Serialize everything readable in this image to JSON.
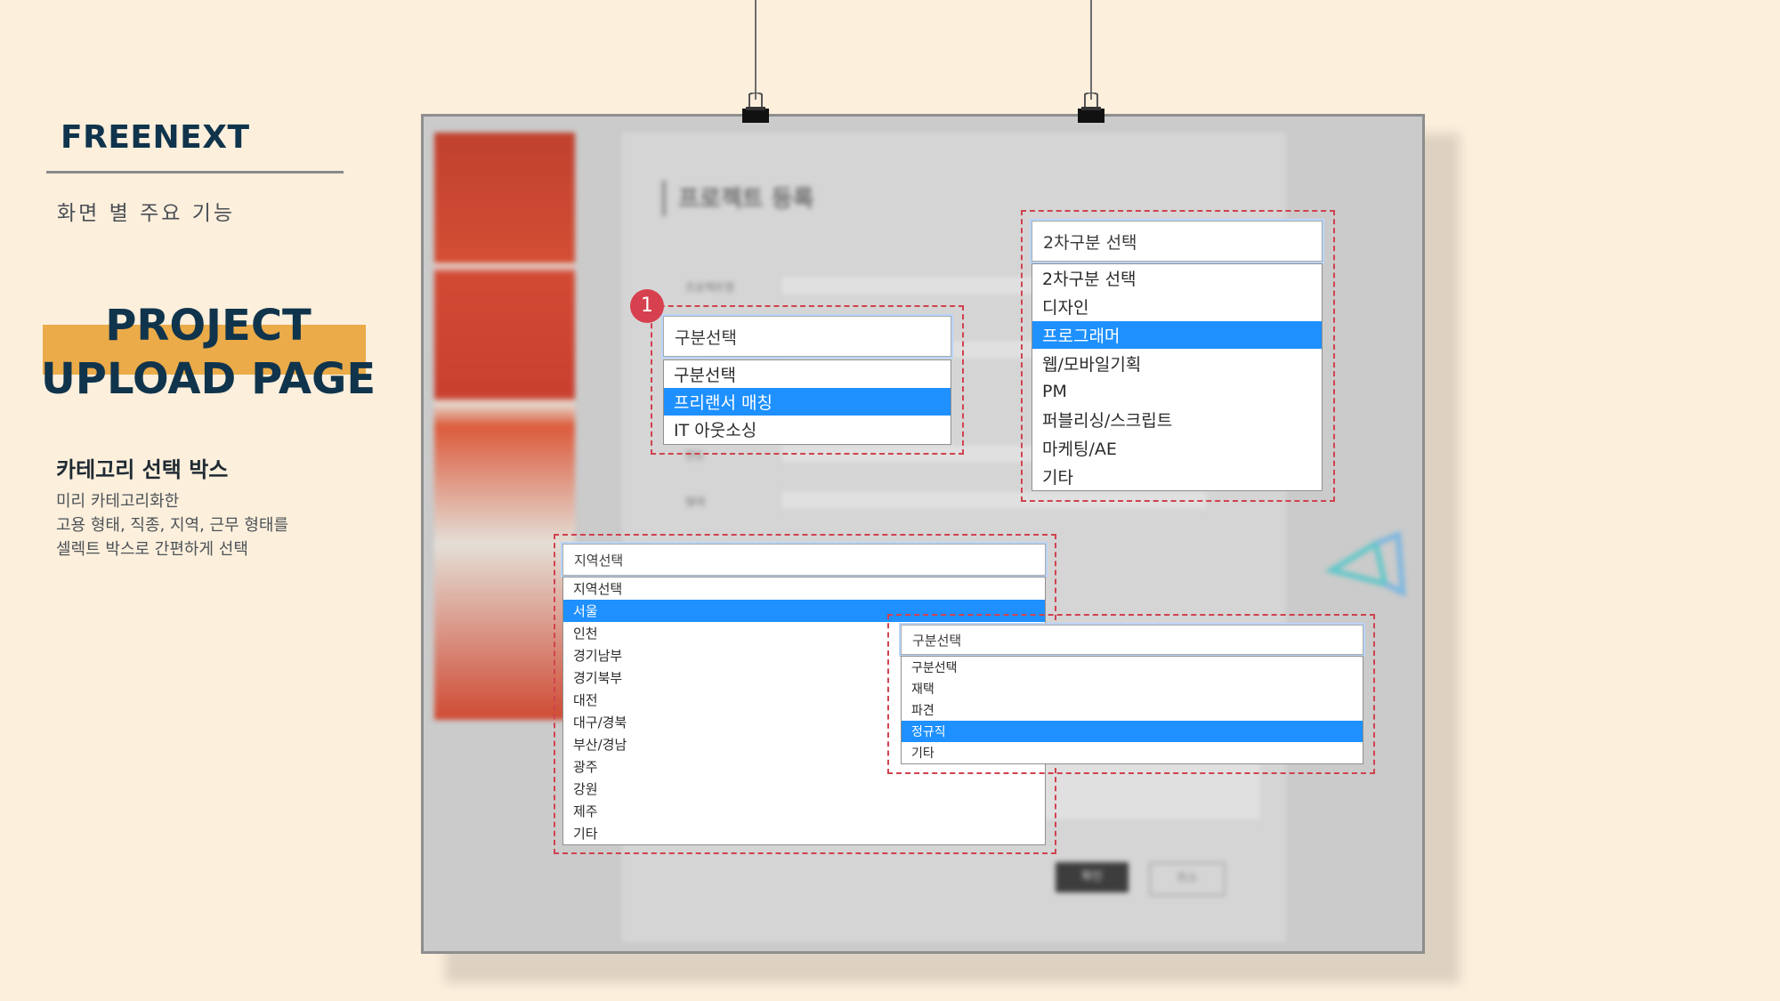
{
  "left_panel": {
    "brand": "FREENEXT",
    "subtitle": "화면 별 주요 기능",
    "title": "PROJECT\nUPLOAD PAGE",
    "section_heading": "카테고리 선택 박스",
    "section_desc": [
      "미리 카테고리화한",
      "고용 형태,  직종, 지역, 근무 형태를",
      "셀렉트 박스로 간편하게 선택"
    ]
  },
  "background_page": {
    "title": "프로젝트 등록",
    "confirm_label": "확인",
    "cancel_label": "취소",
    "labels": [
      "프로젝트명",
      "분류",
      "연도",
      "형태"
    ]
  },
  "badge": "1",
  "category_select": {
    "value": "구분선택",
    "options": [
      "구분선택",
      "프리랜서 매칭",
      "IT 아웃소싱"
    ],
    "selected_index": 1
  },
  "subcategory_select": {
    "value": "2차구분 선택",
    "options": [
      "2차구분 선택",
      "디자인",
      "프로그래머",
      "웹/모바일기획",
      "PM",
      "퍼블리싱/스크립트",
      "마케팅/AE",
      "기타"
    ],
    "selected_index": 2
  },
  "region_select": {
    "value": "지역선택",
    "options": [
      "지역선택",
      "서울",
      "인천",
      "경기남부",
      "경기북부",
      "대전",
      "대구/경북",
      "부산/경남",
      "광주",
      "강원",
      "제주",
      "기타"
    ],
    "selected_index": 1
  },
  "worktype_select": {
    "value": "구분선택",
    "options": [
      "구분선택",
      "재택",
      "파견",
      "정규직",
      "기타"
    ],
    "selected_index": 3
  },
  "colors": {
    "background": "#fcefdc",
    "brand_navy": "#10344c",
    "accent_orange": "#ebab48",
    "callout_red": "#d0424f",
    "selection_blue": "#1e90ff"
  }
}
